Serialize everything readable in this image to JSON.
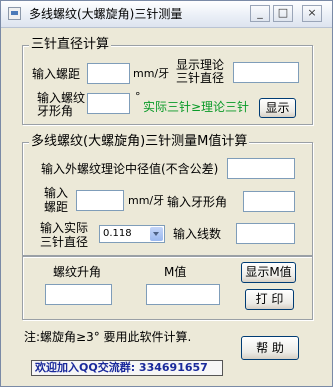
{
  "window": {
    "title": "多线螺纹(大螺旋角)三针测量",
    "controls": [
      "_",
      "□",
      "×"
    ]
  },
  "group1": {
    "title": "三针直径计算",
    "pitch_label": "输入螺距",
    "pitch_value": "",
    "pitch_unit": "mm/牙",
    "show_theory_label_1": "显示理论",
    "show_theory_label_2": "三针直径",
    "show_theory_value": "",
    "angle_label_1": "输入螺纹",
    "angle_label_2": "牙形角",
    "angle_value": "",
    "degree_sign": "°",
    "hint": "实际三针≥理论三针",
    "show_button": "显示"
  },
  "group2": {
    "title": "多线螺纹(大螺旋角)三针测量M值计算",
    "pitch_diam_label": "输入外螺纹理论中径值(不含公差)",
    "pitch_diam_value": "",
    "pitch_label_1": "输入",
    "pitch_label_2": "螺距",
    "pitch_value": "",
    "pitch_unit": "mm/牙",
    "angle_label": "输入牙形角",
    "angle_value": "",
    "actual_label_1": "输入实际",
    "actual_label_2": "三针直径",
    "actual_value": "0.118",
    "threads_label": "输入线数",
    "threads_value": ""
  },
  "group3": {
    "lead_angle_label": "螺纹升角",
    "lead_angle_value": "",
    "m_label": "M值",
    "m_value": "",
    "show_m_button": "显示M值",
    "print_button": "打 印"
  },
  "note": "注:螺旋角≥3° 要用此软件计算.",
  "help_button": "帮  助",
  "qq_text": "欢迎加入QQ交流群: 334691657"
}
